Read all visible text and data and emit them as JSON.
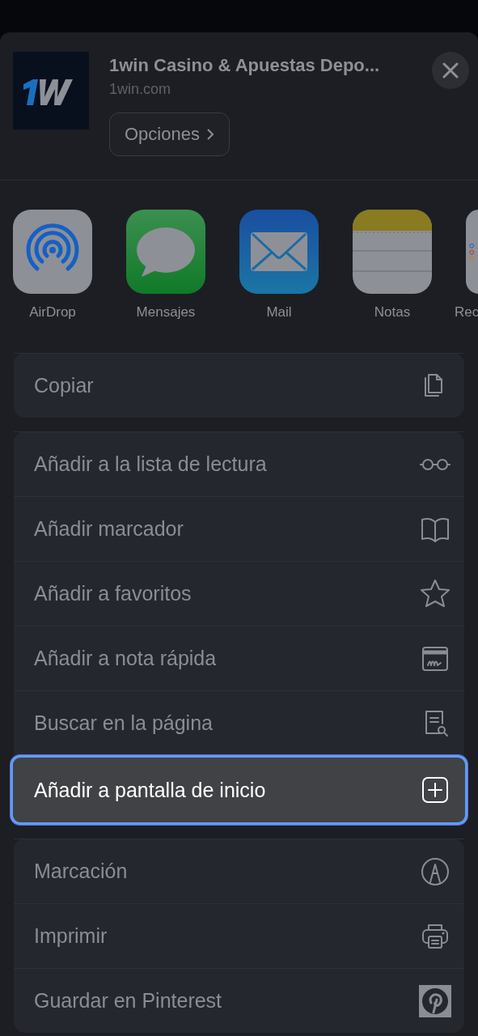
{
  "header": {
    "title": "1win Casino & Apuestas Depo...",
    "url": "1win.com",
    "options_button": "Opciones"
  },
  "apps": [
    {
      "label": "AirDrop"
    },
    {
      "label": "Mensajes"
    },
    {
      "label": "Mail"
    },
    {
      "label": "Notas"
    },
    {
      "label": "Rec"
    }
  ],
  "action_groups": [
    {
      "items": [
        {
          "label": "Copiar",
          "selected": false
        }
      ]
    },
    {
      "items": [
        {
          "label": "Añadir a la lista de lectura",
          "selected": false
        },
        {
          "label": "Añadir marcador",
          "selected": false
        },
        {
          "label": "Añadir a favoritos",
          "selected": false
        },
        {
          "label": "Añadir a nota rápida",
          "selected": false
        },
        {
          "label": "Buscar en la página",
          "selected": false
        },
        {
          "label": "Añadir a pantalla de inicio",
          "selected": true
        }
      ]
    },
    {
      "items": [
        {
          "label": "Marcación",
          "selected": false
        },
        {
          "label": "Imprimir",
          "selected": false
        },
        {
          "label": "Guardar en Pinterest",
          "selected": false
        }
      ]
    }
  ]
}
